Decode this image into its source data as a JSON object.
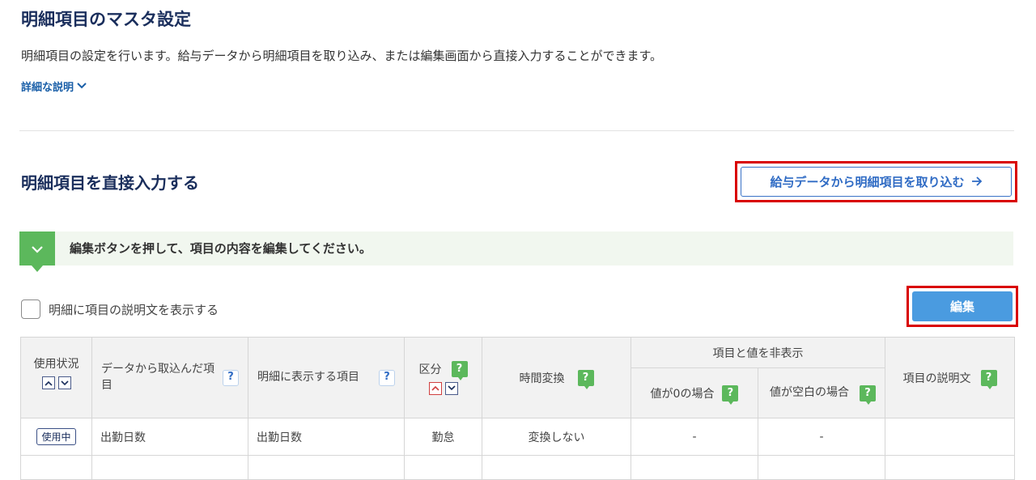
{
  "page": {
    "title": "明細項目のマスタ設定",
    "description": "明細項目の設定を行います。給与データから明細項目を取り込み、または編集画面から直接入力することができます。",
    "detail_link": "詳細な説明"
  },
  "section": {
    "title": "明細項目を直接入力する",
    "import_button": "給与データから明細項目を取り込む",
    "notice": "編集ボタンを押して、項目の内容を編集してください。",
    "checkbox_label": "明細に項目の説明文を表示する",
    "edit_button": "編集"
  },
  "table": {
    "headers": {
      "status": "使用状況",
      "imported": "データから取込んだ項目",
      "display": "明細に表示する項目",
      "category": "区分",
      "time_conversion": "時間変換",
      "hide_group": "項目と値を非表示",
      "when_zero": "値が0の場合",
      "when_blank": "値が空白の場合",
      "description": "項目の説明文"
    },
    "help_mark": "?",
    "rows": [
      {
        "status": "使用中",
        "imported": "出勤日数",
        "display": "出勤日数",
        "category": "勤怠",
        "time_conversion": "変換しない",
        "when_zero": "-",
        "when_blank": "-",
        "description": ""
      }
    ]
  },
  "colors": {
    "title": "#1a2e5c",
    "link": "#2f6bc4",
    "edit_button": "#4a9be0",
    "notice_bg": "#f1f7ef",
    "badge_green": "#5cb85c",
    "highlight_red": "#d90000"
  },
  "icons": {
    "detail_link": "chevron-down-icon",
    "import_button": "arrow-right-icon",
    "notice": "chevron-down-icon",
    "sort": [
      "chevron-up-icon",
      "chevron-down-icon"
    ]
  }
}
